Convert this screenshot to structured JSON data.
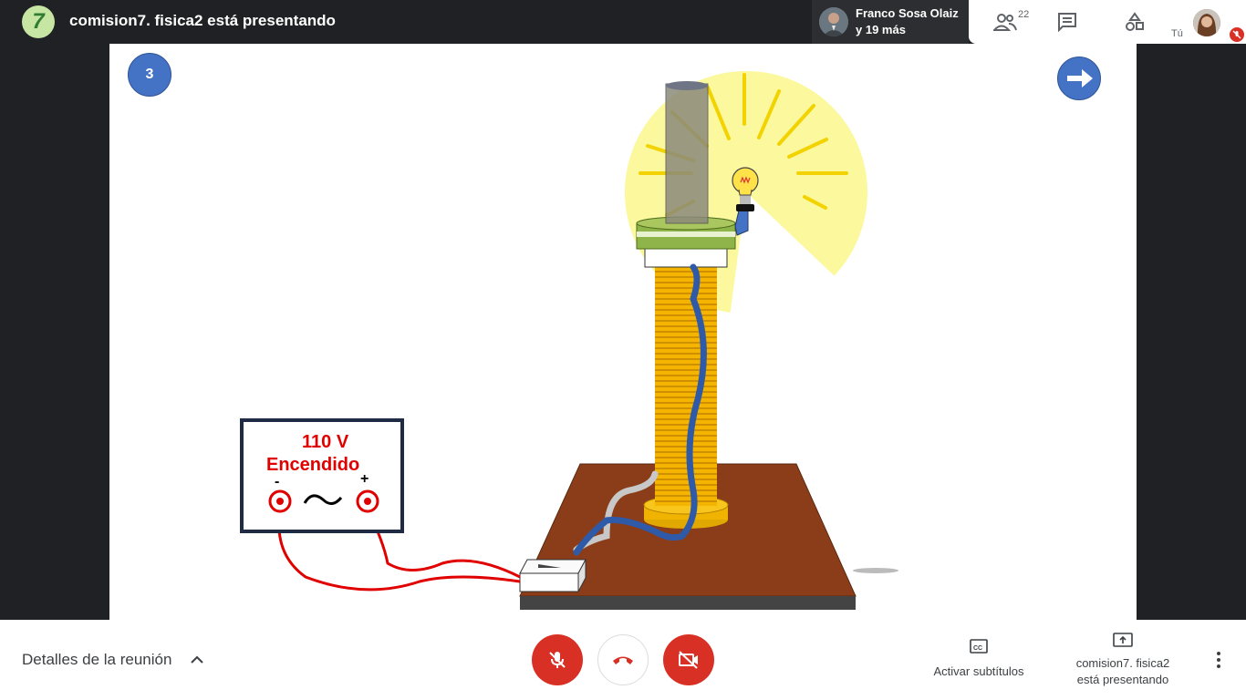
{
  "header": {
    "meeting_title": "comision7. fisica2 está presentando",
    "presenter_name": "Franco Sosa Olaiz",
    "presenter_more": "y 19 más",
    "participants_count": "22",
    "self_label": "Tú"
  },
  "slide": {
    "slide_number": "3",
    "supply_voltage": "110 V",
    "supply_status": "Encendido",
    "minus_sign": "-",
    "plus_sign": "+"
  },
  "footer": {
    "details_label": "Detalles de la reunión",
    "captions_label": "Activar subtítulos",
    "presenting_label_1": "comision7. fisica2",
    "presenting_label_2": "está presentando"
  },
  "colors": {
    "end_call_red": "#d93025",
    "slide_blue": "#4472c4",
    "supply_text_red": "#e00000"
  }
}
